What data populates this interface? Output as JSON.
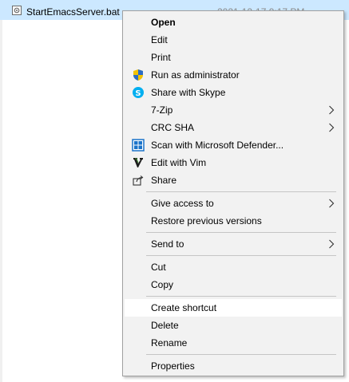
{
  "file": {
    "name": "StartEmacsServer.bat",
    "date_partial": "2021-12-17 9:17 PM"
  },
  "menu": {
    "items": [
      {
        "label": "Open",
        "bold": true
      },
      {
        "label": "Edit"
      },
      {
        "label": "Print"
      },
      {
        "label": "Run as administrator",
        "icon": "shield-icon"
      },
      {
        "label": "Share with Skype",
        "icon": "skype-icon"
      },
      {
        "label": "7-Zip",
        "submenu": true
      },
      {
        "label": "CRC SHA",
        "submenu": true
      },
      {
        "label": "Scan with Microsoft Defender...",
        "icon": "defender-icon"
      },
      {
        "label": "Edit with Vim",
        "icon": "vim-icon"
      },
      {
        "label": "Share",
        "icon": "share-icon"
      },
      {
        "label": "Give access to",
        "submenu": true
      },
      {
        "label": "Restore previous versions"
      },
      {
        "label": "Send to",
        "submenu": true
      },
      {
        "label": "Cut"
      },
      {
        "label": "Copy"
      },
      {
        "label": "Create shortcut",
        "hovered": true
      },
      {
        "label": "Delete"
      },
      {
        "label": "Rename"
      },
      {
        "label": "Properties"
      }
    ]
  },
  "colors": {
    "selection": "#cce8ff",
    "menu_bg": "#f2f2f2",
    "hover_bg": "#ffffff",
    "shield_blue": "#2b6cc4",
    "shield_yellow": "#f2c200",
    "skype_blue": "#00aff0",
    "defender_blue": "#1a73c9"
  }
}
